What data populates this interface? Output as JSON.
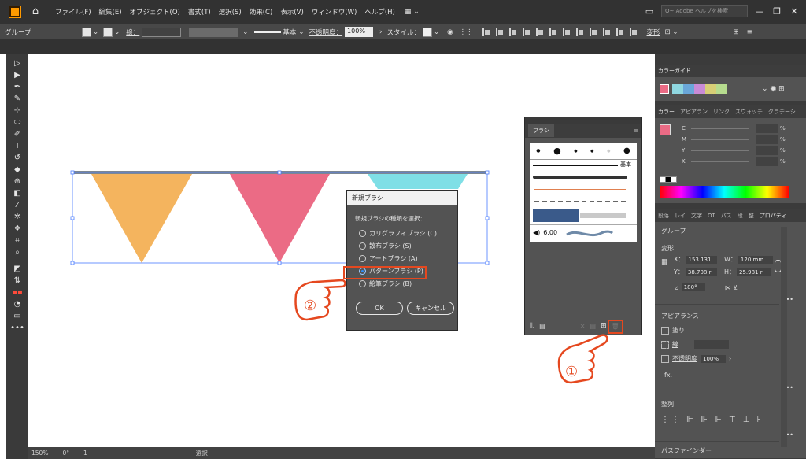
{
  "menubar": {
    "items": [
      "ファイル(F)",
      "編集(E)",
      "オブジェクト(O)",
      "書式(T)",
      "選択(S)",
      "効果(C)",
      "表示(V)",
      "ウィンドウ(W)",
      "ヘルプ(H)"
    ],
    "search_placeholder": "Q~ Adobe ヘルプを検索"
  },
  "controlbar": {
    "selection_label": "グループ",
    "stroke_label": "線：",
    "brush_label": "基本",
    "opacity_label": "不透明度：",
    "opacity_value": "100%",
    "style_label": "スタイル：",
    "transform_label": "変形"
  },
  "statusbar": {
    "zoom": "150%",
    "angle": "0°",
    "artboard": "1",
    "tool": "選択"
  },
  "colors": {
    "flag_orange": "#f4b45e",
    "flag_pink": "#eb6b85",
    "flag_cyan": "#7fdfe6",
    "highlight": "#e5481f",
    "selection": "#4a7cff"
  },
  "brush_panel": {
    "tab": "ブラシ",
    "size_value": "6.00",
    "basic_label": "基本"
  },
  "dialog": {
    "title": "新規ブラシ",
    "prompt": "新規ブラシの種類を選択：",
    "options": [
      {
        "label": "カリグラフィブラシ (C)",
        "checked": false
      },
      {
        "label": "散布ブラシ (S)",
        "checked": false
      },
      {
        "label": "アートブラシ (A)",
        "checked": false
      },
      {
        "label": "パターンブラシ (P)",
        "checked": true
      },
      {
        "label": "絵筆ブラシ (B)",
        "checked": false
      }
    ],
    "ok_label": "OK",
    "cancel_label": "キャンセル"
  },
  "callouts": {
    "step1": "①",
    "step2": "②"
  },
  "color_guide": {
    "tab": "カラーガイド"
  },
  "color_panel": {
    "tabs": [
      "カラー",
      "アピアラン",
      "リンク",
      "スウォッチ",
      "グラデーシ"
    ],
    "channels": [
      "C",
      "M",
      "Y",
      "K"
    ],
    "unit": "%"
  },
  "properties": {
    "tabs": [
      "段落",
      "レイ",
      "文字",
      "OT",
      "パス",
      "段",
      "整",
      "プロパティ"
    ],
    "group_label": "グループ",
    "transform_label": "変形",
    "x_label": "X：",
    "x_value": "153.131",
    "y_label": "Y：",
    "y_value": "38.708 r",
    "w_label": "W：",
    "w_value": "120 mm",
    "h_label": "H：",
    "h_value": "25.981 r",
    "rotation": "180°",
    "appearance_label": "アピアランス",
    "fill_label": "塗り",
    "stroke_label": "線",
    "opacity_label": "不透明度",
    "opacity_value": "100%",
    "fx_label": "fx.",
    "align_label": "整列",
    "pathfinder_label": "パスファインダー"
  }
}
